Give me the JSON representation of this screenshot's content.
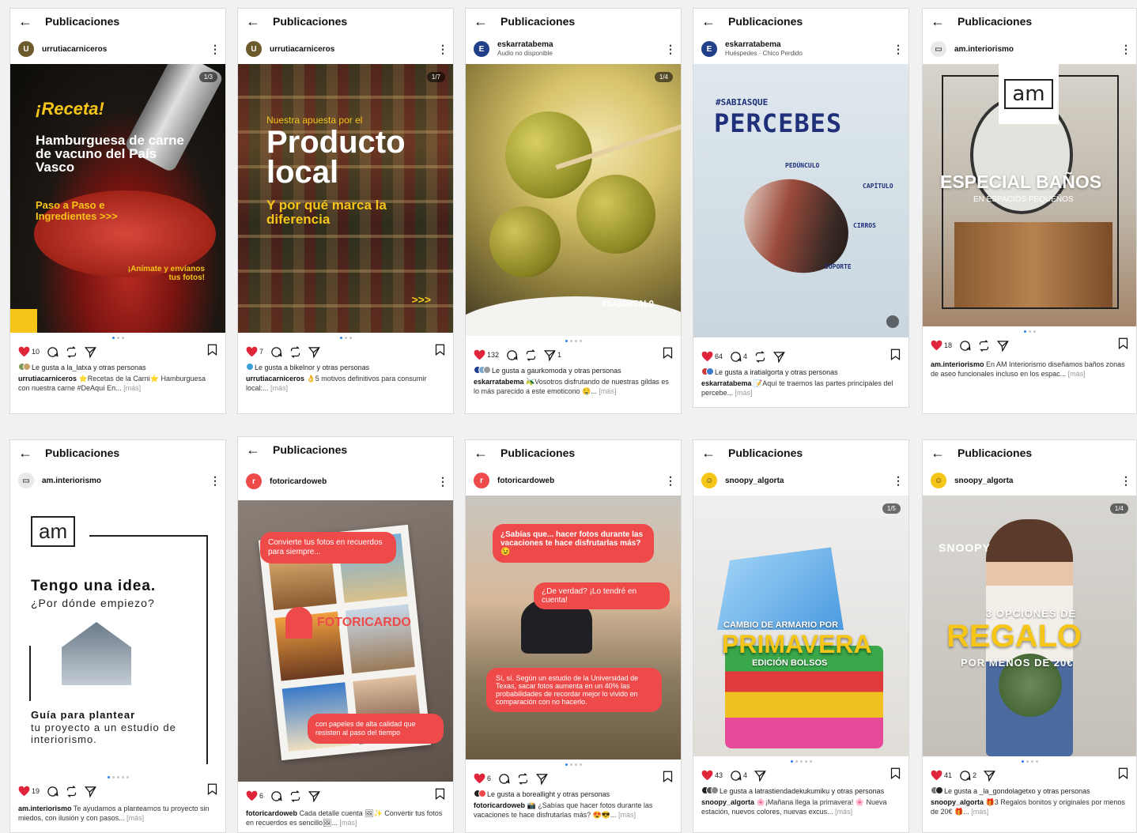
{
  "header_title": "Publicaciones",
  "more_label": "[más]",
  "cards": [
    {
      "username": "urrutiacarniceros",
      "subtitle": "",
      "counter": "1/3",
      "likes": "10",
      "comments": "",
      "shares": "",
      "liked_by": "Le gusta a la_latxa y otras personas",
      "caption": "⭐Recetas de la Carni⭐ Hamburguesa con nuestra carne #DeAquí En...",
      "poster": {
        "line1": "¡Receta!",
        "line2": "Hamburguesa de carne de vacuno del País Vasco",
        "line3": "Paso a Paso e Ingredientes >>>",
        "line4": "¡Anímate y envíanos tus fotos!"
      }
    },
    {
      "username": "urrutiacarniceros",
      "subtitle": "",
      "counter": "1/7",
      "likes": "7",
      "comments": "",
      "shares": "",
      "liked_by": "Le gusta a bikelnor y otras personas",
      "caption": "👌5 motivos definitivos para consumir local:...",
      "poster": {
        "line1": "Nuestra apuesta por el",
        "line2": "Producto local",
        "line3": "Y por qué marca la diferencia",
        "line4": ">>>"
      }
    },
    {
      "username": "eskarratabema",
      "subtitle": "Audio no disponible",
      "counter": "1/4",
      "likes": "132",
      "comments": "",
      "shares": "1",
      "liked_by": "Le gusta a gaurkomoda y otras personas",
      "caption": "🫒Vosotros disfrutando de nuestras gildas es lo más parecido a este emoticono 🤤...",
      "poster": {
        "line1": "#SABOREALO"
      }
    },
    {
      "username": "eskarratabema",
      "subtitle": "Huéspedes · Chico Perdido",
      "counter": "",
      "likes": "64",
      "comments": "4",
      "shares": "",
      "liked_by": "Le gusta a iratialgorta y otras personas",
      "caption": "📝Aquí te traemos las partes principales del percebe...",
      "poster": {
        "line1": "#SABIASQUE",
        "line2": "PERCEBES",
        "line3": "PEDÚNCULO",
        "line4": "CAPÍTULO",
        "line5": "CIRROS",
        "line6": "SOPORTE"
      }
    },
    {
      "username": "am.interiorismo",
      "subtitle": "",
      "counter": "",
      "likes": "18",
      "comments": "",
      "shares": "",
      "liked_by": "",
      "caption": "En AM Interiorismo diseñamos baños zonas de aseo funcionales incluso en los espac...",
      "poster": {
        "logo": "am",
        "line1": "ESPECIAL BAÑOS",
        "line2": "EN ESPACIOS PEQUEÑOS"
      }
    },
    {
      "username": "am.interiorismo",
      "subtitle": "",
      "counter": "",
      "likes": "19",
      "comments": "",
      "shares": "",
      "liked_by": "",
      "caption": "Te ayudamos a plantearnos tu proyecto sin miedos, con ilusión y con pasos...",
      "poster": {
        "logo": "am",
        "line1": "Tengo una idea.",
        "line2": "¿Por dónde empiezo?",
        "line3": "Guía para plantear",
        "line4": "tu proyecto a un estudio de interiorismo."
      }
    },
    {
      "username": "fotoricardoweb",
      "subtitle": "",
      "counter": "",
      "likes": "6",
      "comments": "",
      "shares": "",
      "liked_by": "",
      "caption": "Cada detalle cuenta 🖼✨ Convertir tus fotos en recuerdos es sencillo🖼...",
      "poster": {
        "line1": "Convierte tus fotos en recuerdos para siempre...",
        "line2": "FOTORICARDO",
        "line3": "con papeles de alta calidad que resisten al paso del tiempo"
      }
    },
    {
      "username": "fotoricardoweb",
      "subtitle": "",
      "counter": "",
      "likes": "6",
      "comments": "",
      "shares": "",
      "liked_by": "Le gusta a boreallight y otras personas",
      "caption": "📸 ¿Sabías que hacer fotos durante las vacaciones te hace disfrutarlas más? 😍😎...",
      "poster": {
        "line1": "¿Sabías que... hacer fotos durante las vacaciones te hace disfrutarlas más? 😉",
        "line2": "¿De verdad? ¡Lo tendré en cuenta!",
        "line3": "Sí, sí. Según un estudio de la Universidad de Texas, sacar fotos aumenta en un 40% las probabilidades de recordar mejor lo vivido en comparación con no hacerlo."
      }
    },
    {
      "username": "snoopy_algorta",
      "subtitle": "",
      "counter": "1/5",
      "likes": "43",
      "comments": "4",
      "shares": "",
      "liked_by": "Le gusta a latrastiendadekukumiku y otras personas",
      "caption": "🌸¡Mañana llega la primavera! 🌸 Nueva estación, nuevos colores, nuevas excus...",
      "poster": {
        "line1": "CAMBIO DE ARMARIO POR",
        "line2": "PRIMAVERA",
        "line3": "EDICIÓN BOLSOS"
      }
    },
    {
      "username": "snoopy_algorta",
      "subtitle": "",
      "counter": "1/4",
      "likes": "41",
      "comments": "2",
      "shares": "",
      "liked_by": "Le gusta a _la_gondolagetxo y otras personas",
      "caption": "🎁3 Regalos bonitos y originales por menos de 20€ 🎁...",
      "poster": {
        "brand": "SNOOPY",
        "line1": "3 OPCIONES DE",
        "line2": "REGALO",
        "line3": "POR MENOS DE 20€"
      }
    }
  ],
  "colors": {
    "heart": "#e0243a",
    "pager_active": "#2f7ef0",
    "percebes_blue": "#1f2f7a",
    "fotoricardo_red": "#ef4a4a"
  }
}
